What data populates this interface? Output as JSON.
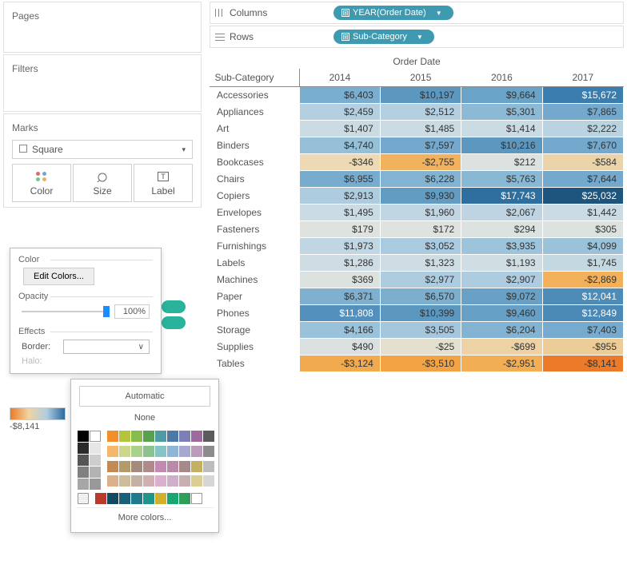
{
  "panels": {
    "pages": "Pages",
    "filters": "Filters",
    "marks": "Marks"
  },
  "mark_type": {
    "label": "Square",
    "caret": "▾"
  },
  "mark_buttons": {
    "color": "Color",
    "size": "Size",
    "label": "Label"
  },
  "color_popup": {
    "section_color": "Color",
    "edit": "Edit Colors...",
    "opacity_label": "Opacity",
    "opacity_value": "100%",
    "section_effects": "Effects",
    "border": "Border:",
    "halo": "Halo:",
    "caret": "∨"
  },
  "legend": {
    "min": "-$8,141"
  },
  "picker": {
    "automatic": "Automatic",
    "none": "None",
    "more": "More colors...",
    "bw": [
      "#000000",
      "#ffffff",
      "#2b2b2b",
      "#e6e6e6",
      "#555555",
      "#cdcdcd",
      "#808080",
      "#b3b3b3",
      "#a6a6a6",
      "#999999"
    ],
    "row1": [
      "#f28e2b",
      "#b6c43b",
      "#86bc4a",
      "#59a14f",
      "#4e9ba6",
      "#4e79a7",
      "#7b7fb5",
      "#9c6a9c",
      "#5b5b5b"
    ],
    "row2": [
      "#f5b76a",
      "#cdd68a",
      "#a8d18a",
      "#8cc28b",
      "#86c3c7",
      "#8fb6d6",
      "#a6a8cf",
      "#bb9abb",
      "#8c8c8c"
    ],
    "row3": [
      "#c48a55",
      "#b39a6a",
      "#a38a7a",
      "#b08a8a",
      "#c28ab0",
      "#b88aa6",
      "#a68a8a",
      "#c4b060",
      "#bdbdbd"
    ],
    "row4": [
      "#dcb08a",
      "#cdbd9a",
      "#c3b0a6",
      "#cfb0b0",
      "#dab0cf",
      "#d0b0c8",
      "#c8b0b0",
      "#dccd90",
      "#d6d6d6"
    ],
    "bottom_left": "#f0f0f0",
    "bottom": [
      "#b93a2b",
      "#134a63",
      "#1b6078",
      "#1f7a8c",
      "#1f958c",
      "#d1b02b",
      "#1aa673",
      "#2e9e5b",
      "#ffffff"
    ]
  },
  "shelves": {
    "columns_label": "Columns",
    "rows_label": "Rows",
    "col_pill": "YEAR(Order Date)",
    "row_pill": "Sub-Category"
  },
  "chart_data": {
    "type": "table",
    "title": "Order Date",
    "row_header": "Sub-Category",
    "columns": [
      "2014",
      "2015",
      "2016",
      "2017"
    ],
    "rows": [
      {
        "label": "Accessories",
        "cells": [
          {
            "v": "$6,403",
            "c": "#7aaed0"
          },
          {
            "v": "$10,197",
            "c": "#5c97c0"
          },
          {
            "v": "$9,664",
            "c": "#6aa3c8"
          },
          {
            "v": "$15,672",
            "c": "#3a7eb0",
            "w": 1
          }
        ]
      },
      {
        "label": "Appliances",
        "cells": [
          {
            "v": "$2,459",
            "c": "#b4cfe0"
          },
          {
            "v": "$2,512",
            "c": "#b4cfe0"
          },
          {
            "v": "$5,301",
            "c": "#8cbad6"
          },
          {
            "v": "$7,865",
            "c": "#74a8cc"
          }
        ]
      },
      {
        "label": "Art",
        "cells": [
          {
            "v": "$1,407",
            "c": "#cadbe4"
          },
          {
            "v": "$1,485",
            "c": "#cadbe4"
          },
          {
            "v": "$1,414",
            "c": "#cadbe4"
          },
          {
            "v": "$2,222",
            "c": "#bad3e0"
          }
        ]
      },
      {
        "label": "Binders",
        "cells": [
          {
            "v": "$4,740",
            "c": "#95c0d8"
          },
          {
            "v": "$7,597",
            "c": "#74a8cc"
          },
          {
            "v": "$10,216",
            "c": "#5c97c0"
          },
          {
            "v": "$7,670",
            "c": "#74a8cc"
          }
        ]
      },
      {
        "label": "Bookcases",
        "cells": [
          {
            "v": "-$346",
            "c": "#eed9b5"
          },
          {
            "v": "-$2,755",
            "c": "#f2b15c"
          },
          {
            "v": "$212",
            "c": "#dce2e0"
          },
          {
            "v": "-$584",
            "c": "#ecd4aa"
          }
        ]
      },
      {
        "label": "Chairs",
        "cells": [
          {
            "v": "$6,955",
            "c": "#78acce"
          },
          {
            "v": "$6,228",
            "c": "#82b3d2"
          },
          {
            "v": "$5,763",
            "c": "#88b8d4"
          },
          {
            "v": "$7,644",
            "c": "#74a8cc"
          }
        ]
      },
      {
        "label": "Copiers",
        "cells": [
          {
            "v": "$2,913",
            "c": "#aecce0"
          },
          {
            "v": "$9,930",
            "c": "#629cc2"
          },
          {
            "v": "$17,743",
            "c": "#2f6fa0",
            "w": 1
          },
          {
            "v": "$25,032",
            "c": "#1e557e",
            "w": 1
          }
        ]
      },
      {
        "label": "Envelopes",
        "cells": [
          {
            "v": "$1,495",
            "c": "#cadbe4"
          },
          {
            "v": "$1,960",
            "c": "#c0d6e2"
          },
          {
            "v": "$2,067",
            "c": "#bed4e2"
          },
          {
            "v": "$1,442",
            "c": "#cadbe4"
          }
        ]
      },
      {
        "label": "Fasteners",
        "cells": [
          {
            "v": "$179",
            "c": "#dee3e0"
          },
          {
            "v": "$172",
            "c": "#dee3e0"
          },
          {
            "v": "$294",
            "c": "#dce2e0"
          },
          {
            "v": "$305",
            "c": "#dce2e0"
          }
        ]
      },
      {
        "label": "Furnishings",
        "cells": [
          {
            "v": "$1,973",
            "c": "#c0d6e2"
          },
          {
            "v": "$3,052",
            "c": "#aacae0"
          },
          {
            "v": "$3,935",
            "c": "#9ec4dc"
          },
          {
            "v": "$4,099",
            "c": "#9cc2da"
          }
        ]
      },
      {
        "label": "Labels",
        "cells": [
          {
            "v": "$1,286",
            "c": "#cedde4"
          },
          {
            "v": "$1,323",
            "c": "#cedde4"
          },
          {
            "v": "$1,193",
            "c": "#d0dee4"
          },
          {
            "v": "$1,745",
            "c": "#c4d8e2"
          }
        ]
      },
      {
        "label": "Machines",
        "cells": [
          {
            "v": "$369",
            "c": "#dce2e0"
          },
          {
            "v": "$2,977",
            "c": "#aecce0"
          },
          {
            "v": "$2,907",
            "c": "#aecce0"
          },
          {
            "v": "-$2,869",
            "c": "#f2b05a"
          }
        ]
      },
      {
        "label": "Paper",
        "cells": [
          {
            "v": "$6,371",
            "c": "#80b0d0"
          },
          {
            "v": "$6,570",
            "c": "#7caece"
          },
          {
            "v": "$9,072",
            "c": "#68a0c6"
          },
          {
            "v": "$12,041",
            "c": "#4e8cb8",
            "w": 1
          }
        ]
      },
      {
        "label": "Phones",
        "cells": [
          {
            "v": "$11,808",
            "c": "#5490bc",
            "w": 1
          },
          {
            "v": "$10,399",
            "c": "#5c97c0"
          },
          {
            "v": "$9,460",
            "c": "#66a0c6"
          },
          {
            "v": "$12,849",
            "c": "#4a88b6",
            "w": 1
          }
        ]
      },
      {
        "label": "Storage",
        "cells": [
          {
            "v": "$4,166",
            "c": "#9ac2da"
          },
          {
            "v": "$3,505",
            "c": "#a4c7de"
          },
          {
            "v": "$6,204",
            "c": "#82b3d2"
          },
          {
            "v": "$7,403",
            "c": "#76aace"
          }
        ]
      },
      {
        "label": "Supplies",
        "cells": [
          {
            "v": "$490",
            "c": "#dae0e0"
          },
          {
            "v": "-$25",
            "c": "#e4e0d0"
          },
          {
            "v": "-$699",
            "c": "#ecd2a5"
          },
          {
            "v": "-$955",
            "c": "#eccd98"
          }
        ]
      },
      {
        "label": "Tables",
        "cells": [
          {
            "v": "-$3,124",
            "c": "#f2aa4e"
          },
          {
            "v": "-$3,510",
            "c": "#f2a444"
          },
          {
            "v": "-$2,951",
            "c": "#f2ae54"
          },
          {
            "v": "-$8,141",
            "c": "#ec7a28"
          }
        ]
      }
    ]
  }
}
